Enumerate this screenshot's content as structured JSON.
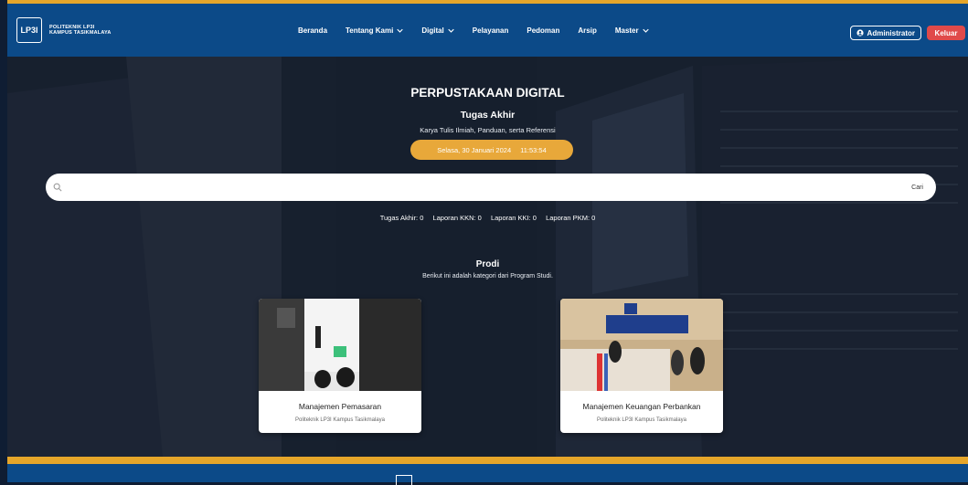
{
  "brand": {
    "logo_text": "LP3I",
    "name_line1": "POLITEKNIK LP3I",
    "name_line2": "KAMPUS TASIKMALAYA"
  },
  "nav": {
    "items": [
      {
        "label": "Beranda",
        "dropdown": false
      },
      {
        "label": "Tentang Kami",
        "dropdown": true
      },
      {
        "label": "Digital",
        "dropdown": true
      },
      {
        "label": "Pelayanan",
        "dropdown": false
      },
      {
        "label": "Pedoman",
        "dropdown": false
      },
      {
        "label": "Arsip",
        "dropdown": false
      },
      {
        "label": "Master",
        "dropdown": true
      }
    ],
    "admin_label": "Administrator",
    "logout_label": "Keluar"
  },
  "hero": {
    "title": "PERPUSTAKAAN DIGITAL",
    "subtitle": "Tugas Akhir",
    "description": "Karya Tulis Ilmiah, Panduan, serta Referensi",
    "date": "Selasa, 30 Januari 2024",
    "time": "11:53:54"
  },
  "search": {
    "placeholder": "",
    "button_label": "Cari"
  },
  "counts": [
    "Tugas Akhir: 0",
    "Laporan KKN: 0",
    "Laporan KKI: 0",
    "Laporan PKM: 0"
  ],
  "prodi": {
    "title": "Prodi",
    "description": "Berikut ini adalah kategori dari Program Studi.",
    "cards": [
      {
        "title": "Manajemen Pemasaran",
        "subtitle": "Politeknik LP3I Kampus Tasikmalaya"
      },
      {
        "title": "Manajemen Keuangan Perbankan",
        "subtitle": "Politeknik LP3I Kampus Tasikmalaya"
      }
    ]
  },
  "colors": {
    "navbar": "#0c4a88",
    "accent": "#e6a62a",
    "logout": "#e04a4a"
  }
}
